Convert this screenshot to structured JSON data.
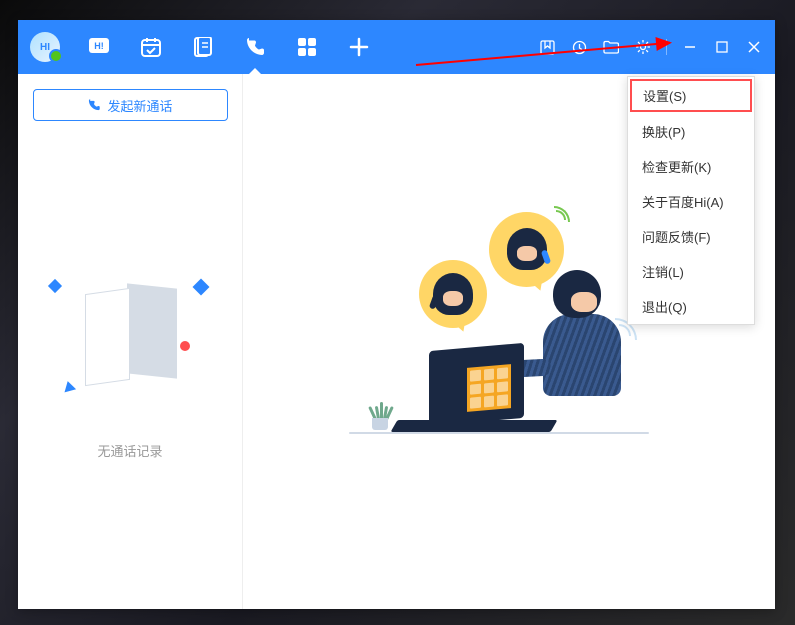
{
  "avatar_label": "HI",
  "toolbar": {
    "icons": [
      "message",
      "calendar",
      "notes",
      "phone",
      "apps",
      "add"
    ],
    "active_index": 3
  },
  "window_controls": {
    "extras": [
      "bookmark",
      "history",
      "folder",
      "settings"
    ],
    "standard": [
      "minimize",
      "maximize",
      "close"
    ]
  },
  "sidebar": {
    "new_call_label": "发起新通话",
    "empty_message": "无通话记录"
  },
  "context_menu": {
    "items": [
      {
        "label": "设置(S)",
        "highlighted": true
      },
      {
        "label": "换肤(P)",
        "highlighted": false
      },
      {
        "label": "检查更新(K)",
        "highlighted": false
      },
      {
        "label": "关于百度Hi(A)",
        "highlighted": false
      },
      {
        "label": "问题反馈(F)",
        "highlighted": false
      },
      {
        "label": "注销(L)",
        "highlighted": false
      },
      {
        "label": "退出(Q)",
        "highlighted": false
      }
    ]
  }
}
